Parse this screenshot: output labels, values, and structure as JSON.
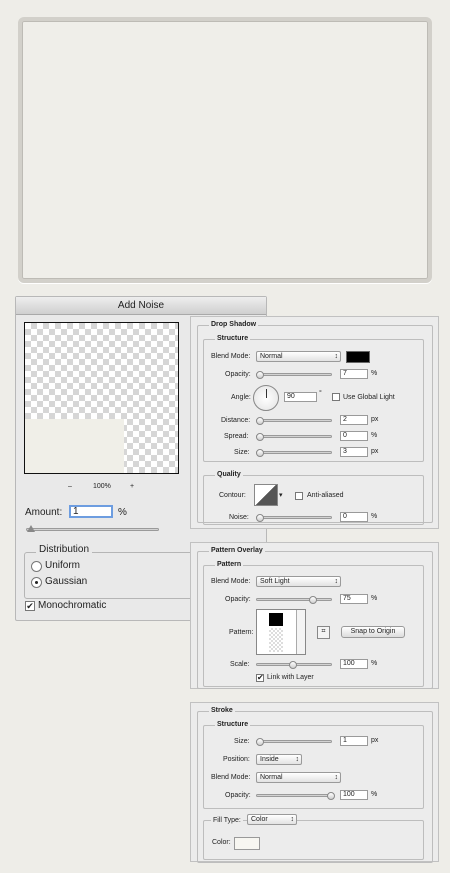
{
  "add_noise": {
    "title": "Add Noise",
    "zoom_minus": "–",
    "zoom_level": "100%",
    "zoom_plus": "+",
    "amount_label": "Amount:",
    "amount_value": "1",
    "amount_unit": "%",
    "amount_level": 0.01,
    "distribution_legend": "Distribution",
    "uniform_label": "Uniform",
    "gaussian_label": "Gaussian",
    "selected_distribution": "Gaussian",
    "monochromatic_label": "Monochromatic",
    "monochromatic_checked": true
  },
  "drop_shadow": {
    "title": "Drop Shadow",
    "structure": "Structure",
    "blend_mode_label": "Blend Mode:",
    "blend_mode": "Normal",
    "color": "#000000",
    "opacity_label": "Opacity:",
    "opacity": "7",
    "opacity_unit": "%",
    "angle_label": "Angle:",
    "angle": "90",
    "degree": "°",
    "use_global_light": "Use Global Light",
    "distance_label": "Distance:",
    "distance": "2",
    "distance_unit": "px",
    "spread_label": "Spread:",
    "spread": "0",
    "spread_unit": "%",
    "size_label": "Size:",
    "size": "3",
    "size_unit": "px",
    "quality": "Quality",
    "contour_label": "Contour:",
    "anti_aliased": "Anti-aliased",
    "noise_label": "Noise:",
    "noise": "0",
    "noise_unit": "%"
  },
  "pattern_overlay": {
    "title": "Pattern Overlay",
    "pattern_group": "Pattern",
    "blend_mode_label": "Blend Mode:",
    "blend_mode": "Soft Light",
    "opacity_label": "Opacity:",
    "opacity": "75",
    "opacity_unit": "%",
    "pattern_label": "Pattern:",
    "snap_to_origin": "Snap to Origin",
    "scale_label": "Scale:",
    "scale": "100",
    "scale_unit": "%",
    "link_with_layer": "Link with Layer",
    "link_checked": true
  },
  "stroke": {
    "title": "Stroke",
    "structure": "Structure",
    "size_label": "Size:",
    "size": "1",
    "size_unit": "px",
    "position_label": "Position:",
    "position": "Inside",
    "blend_mode_label": "Blend Mode:",
    "blend_mode": "Normal",
    "opacity_label": "Opacity:",
    "opacity": "100",
    "opacity_unit": "%",
    "fill_type_label": "Fill Type:",
    "fill_type": "Color",
    "color_label": "Color:",
    "color": "#f7f6f1"
  }
}
